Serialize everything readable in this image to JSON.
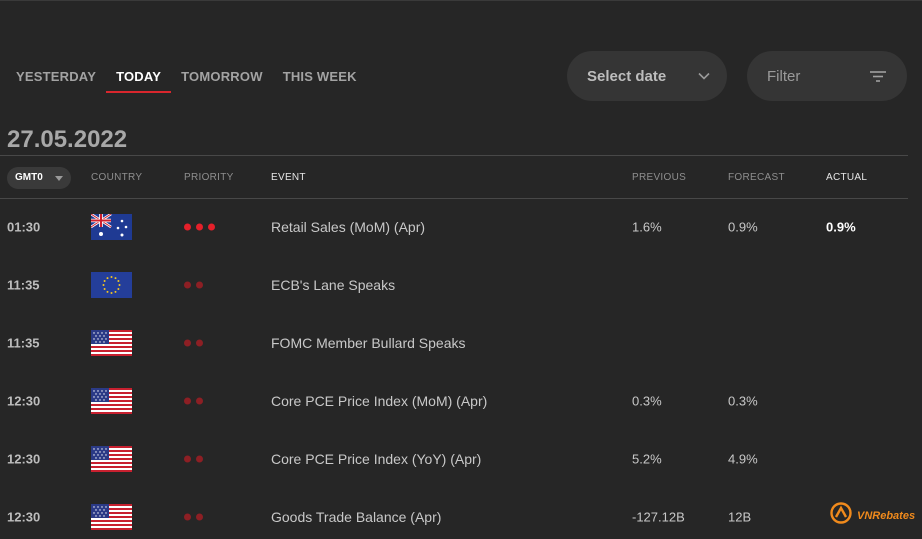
{
  "tabs": [
    {
      "label": "YESTERDAY",
      "active": false
    },
    {
      "label": "TODAY",
      "active": true
    },
    {
      "label": "TOMORROW",
      "active": false
    },
    {
      "label": "THIS WEEK",
      "active": false
    }
  ],
  "controls": {
    "date_select_label": "Select date",
    "filter_placeholder": "Filter"
  },
  "date_heading": "27.05.2022",
  "timezone": "GMT0",
  "columns": {
    "country": "COUNTRY",
    "priority": "PRIORITY",
    "event": "EVENT",
    "previous": "PREVIOUS",
    "forecast": "FORECAST",
    "actual": "ACTUAL"
  },
  "events": [
    {
      "time": "01:30",
      "country": "australia",
      "priority": 3,
      "event": "Retail Sales (MoM) (Apr)",
      "previous": "1.6%",
      "forecast": "0.9%",
      "actual": "0.9%"
    },
    {
      "time": "11:35",
      "country": "european-union",
      "priority": 2,
      "event": "ECB's Lane Speaks",
      "previous": "",
      "forecast": "",
      "actual": ""
    },
    {
      "time": "11:35",
      "country": "united-states",
      "priority": 2,
      "event": "FOMC Member Bullard Speaks",
      "previous": "",
      "forecast": "",
      "actual": ""
    },
    {
      "time": "12:30",
      "country": "united-states",
      "priority": 2,
      "event": "Core PCE Price Index (MoM) (Apr)",
      "previous": "0.3%",
      "forecast": "0.3%",
      "actual": ""
    },
    {
      "time": "12:30",
      "country": "united-states",
      "priority": 2,
      "event": "Core PCE Price Index (YoY) (Apr)",
      "previous": "5.2%",
      "forecast": "4.9%",
      "actual": ""
    },
    {
      "time": "12:30",
      "country": "united-states",
      "priority": 2,
      "event": "Goods Trade Balance (Apr)",
      "previous": "-127.12B",
      "forecast": "12B",
      "actual": ""
    }
  ],
  "watermark": "VNRebates",
  "colors": {
    "accent": "#d9262d",
    "priority_high": "#e5202a",
    "priority_medium": "#8d1f24",
    "watermark": "#f08a1c"
  }
}
